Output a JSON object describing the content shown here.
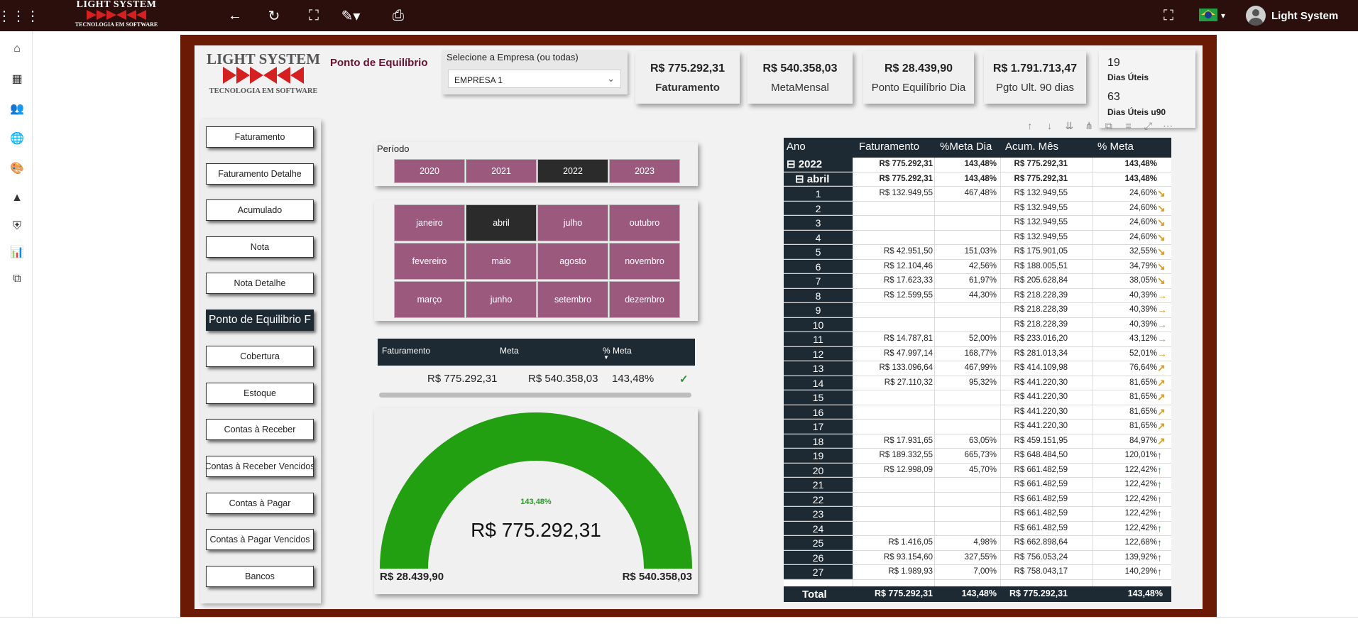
{
  "topbar": {
    "brand": {
      "line1": "LIGHT SYSTEM",
      "line2": "TECNOLOGIA EM SOFTWARE"
    },
    "user_name": "Light System"
  },
  "report": {
    "logo": {
      "line1": "LIGHT SYSTEM",
      "line2": "TECNOLOGIA EM SOFTWARE"
    },
    "title": "Ponto de Equilíbrio",
    "company_label": "Selecione a Empresa (ou todas)",
    "company_value": "EMPRESA 1",
    "kpis": [
      {
        "value": "R$ 775.292,31",
        "caption": "Faturamento"
      },
      {
        "value": "R$ 540.358,03",
        "caption": "MetaMensal"
      },
      {
        "value": "R$ 28.439,90",
        "caption": "Ponto Equilíbrio Dia"
      },
      {
        "value": "R$ 1.791.713,47",
        "caption": "Pgto Ult. 90 dias"
      }
    ],
    "days": [
      {
        "value": "19",
        "caption": "Dias Úteis"
      },
      {
        "value": "63",
        "caption": "Dias Úteis u90"
      }
    ],
    "menu": [
      "Faturamento",
      "Faturamento Detalhe",
      "Acumulado",
      "Nota",
      "Nota Detalhe",
      "Ponto de Equilibrio F",
      "Cobertura",
      "Estoque",
      "Contas à Receber",
      "Contas à Receber Vencidos",
      "Contas à Pagar",
      "Contas à Pagar Vencidos",
      "Bancos"
    ],
    "menu_active": 5,
    "periodo_label": "Período",
    "years": [
      "2020",
      "2021",
      "2022",
      "2023"
    ],
    "year_selected": 2,
    "months": [
      "janeiro",
      "abril",
      "julho",
      "outubro",
      "fevereiro",
      "maio",
      "agosto",
      "novembro",
      "março",
      "junho",
      "setembro",
      "dezembro"
    ],
    "month_selected": 1,
    "meta_table": {
      "headers": [
        "Faturamento",
        "Meta",
        "% Meta"
      ],
      "values": [
        "R$ 775.292,31",
        "R$ 540.358,03",
        "143,48%"
      ]
    },
    "gauge": {
      "value_label": "R$ 775.292,31",
      "pct_label": "143,48%",
      "min_label": "R$ 28.439,90",
      "max_label": "R$ 540.358,03",
      "fill_fraction": 1.0,
      "color": "#22a012"
    },
    "matrix": {
      "headers": [
        "Ano",
        "Faturamento",
        "%Meta Dia",
        "Acum. Mês",
        "% Meta"
      ],
      "year_row": {
        "label": "2022",
        "fat": "R$ 775.292,31",
        "meta_dia": "143,48%",
        "acum": "R$ 775.292,31",
        "pmeta": "143,48%"
      },
      "month_row": {
        "label": "abril",
        "fat": "R$ 775.292,31",
        "meta_dia": "143,48%",
        "acum": "R$ 775.292,31",
        "pmeta": "143,48%"
      },
      "rows": [
        {
          "d": "1",
          "fat": "R$ 132.949,55",
          "md": "467,48%",
          "ac": "R$ 132.949,55",
          "pm": "24,60%",
          "arrow": "down"
        },
        {
          "d": "2",
          "fat": "",
          "md": "",
          "ac": "R$ 132.949,55",
          "pm": "24,60%",
          "arrow": "down"
        },
        {
          "d": "3",
          "fat": "",
          "md": "",
          "ac": "R$ 132.949,55",
          "pm": "24,60%",
          "arrow": "down"
        },
        {
          "d": "4",
          "fat": "",
          "md": "",
          "ac": "R$ 132.949,55",
          "pm": "24,60%",
          "arrow": "down"
        },
        {
          "d": "5",
          "fat": "R$ 42.951,50",
          "md": "151,03%",
          "ac": "R$ 175.901,05",
          "pm": "32,55%",
          "arrow": "down"
        },
        {
          "d": "6",
          "fat": "R$ 12.104,46",
          "md": "42,56%",
          "ac": "R$ 188.005,51",
          "pm": "34,79%",
          "arrow": "down"
        },
        {
          "d": "7",
          "fat": "R$ 17.623,33",
          "md": "61,97%",
          "ac": "R$ 205.628,84",
          "pm": "38,05%",
          "arrow": "down"
        },
        {
          "d": "8",
          "fat": "R$ 12.599,55",
          "md": "44,30%",
          "ac": "R$ 218.228,39",
          "pm": "40,39%",
          "arrow": "right"
        },
        {
          "d": "9",
          "fat": "",
          "md": "",
          "ac": "R$ 218.228,39",
          "pm": "40,39%",
          "arrow": "right"
        },
        {
          "d": "10",
          "fat": "",
          "md": "",
          "ac": "R$ 218.228,39",
          "pm": "40,39%",
          "arrow": "right"
        },
        {
          "d": "11",
          "fat": "R$ 14.787,81",
          "md": "52,00%",
          "ac": "R$ 233.016,20",
          "pm": "43,12%",
          "arrow": "right"
        },
        {
          "d": "12",
          "fat": "R$ 47.997,14",
          "md": "168,77%",
          "ac": "R$ 281.013,34",
          "pm": "52,01%",
          "arrow": "right"
        },
        {
          "d": "13",
          "fat": "R$ 133.096,64",
          "md": "467,99%",
          "ac": "R$ 414.109,98",
          "pm": "76,64%",
          "arrow": "up-right"
        },
        {
          "d": "14",
          "fat": "R$ 27.110,32",
          "md": "95,32%",
          "ac": "R$ 441.220,30",
          "pm": "81,65%",
          "arrow": "up-right"
        },
        {
          "d": "15",
          "fat": "",
          "md": "",
          "ac": "R$ 441.220,30",
          "pm": "81,65%",
          "arrow": "up-right"
        },
        {
          "d": "16",
          "fat": "",
          "md": "",
          "ac": "R$ 441.220,30",
          "pm": "81,65%",
          "arrow": "up-right"
        },
        {
          "d": "17",
          "fat": "",
          "md": "",
          "ac": "R$ 441.220,30",
          "pm": "81,65%",
          "arrow": "up-right"
        },
        {
          "d": "18",
          "fat": "R$ 17.931,65",
          "md": "63,05%",
          "ac": "R$ 459.151,95",
          "pm": "84,97%",
          "arrow": "up-right"
        },
        {
          "d": "19",
          "fat": "R$ 189.332,55",
          "md": "665,73%",
          "ac": "R$ 648.484,50",
          "pm": "120,01%",
          "arrow": "up"
        },
        {
          "d": "20",
          "fat": "R$ 12.998,09",
          "md": "45,70%",
          "ac": "R$ 661.482,59",
          "pm": "122,42%",
          "arrow": "up"
        },
        {
          "d": "21",
          "fat": "",
          "md": "",
          "ac": "R$ 661.482,59",
          "pm": "122,42%",
          "arrow": "up"
        },
        {
          "d": "22",
          "fat": "",
          "md": "",
          "ac": "R$ 661.482,59",
          "pm": "122,42%",
          "arrow": "up"
        },
        {
          "d": "23",
          "fat": "",
          "md": "",
          "ac": "R$ 661.482,59",
          "pm": "122,42%",
          "arrow": "up"
        },
        {
          "d": "24",
          "fat": "",
          "md": "",
          "ac": "R$ 661.482,59",
          "pm": "122,42%",
          "arrow": "up"
        },
        {
          "d": "25",
          "fat": "R$ 1.416,05",
          "md": "4,98%",
          "ac": "R$ 662.898,64",
          "pm": "122,68%",
          "arrow": "up"
        },
        {
          "d": "26",
          "fat": "R$ 93.154,60",
          "md": "327,55%",
          "ac": "R$ 756.053,24",
          "pm": "139,92%",
          "arrow": "up"
        },
        {
          "d": "27",
          "fat": "R$ 1.989,93",
          "md": "7,00%",
          "ac": "R$ 758.043,17",
          "pm": "140,29%",
          "arrow": "up"
        }
      ],
      "total": {
        "label": "Total",
        "fat": "R$ 775.292,31",
        "md": "143,48%",
        "ac": "R$ 775.292,31",
        "pm": "143,48%"
      }
    }
  },
  "colors": {
    "slicer": "#9b5a7d",
    "slicer_selected": "#2b2b2b",
    "header_dark": "#1e2a33",
    "frame": "#6b1a06",
    "gauge": "#22a012",
    "arrow_down": "#d9a020",
    "arrow_up": "#2e7d3a"
  }
}
